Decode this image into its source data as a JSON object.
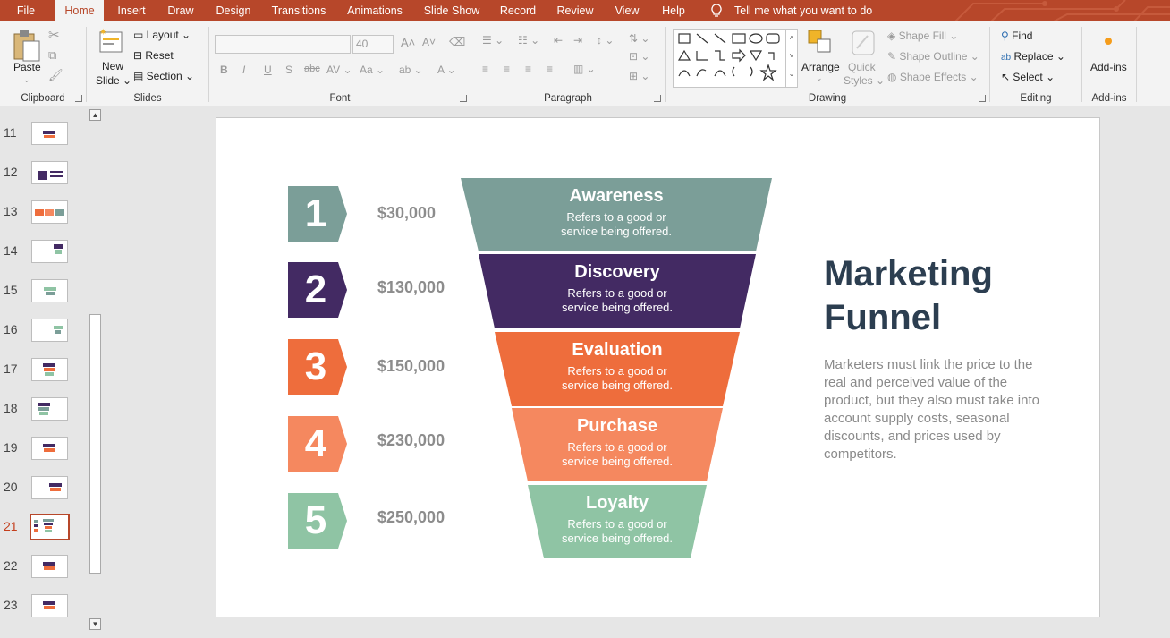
{
  "tabs": [
    "File",
    "Home",
    "Insert",
    "Draw",
    "Design",
    "Transitions",
    "Animations",
    "Slide Show",
    "Record",
    "Review",
    "View",
    "Help"
  ],
  "active_tab": "Home",
  "tell_me": "Tell me what you want to do",
  "ribbon": {
    "clipboard": {
      "label": "Clipboard",
      "paste": "Paste"
    },
    "slides": {
      "label": "Slides",
      "new_slide_1": "New",
      "new_slide_2": "Slide",
      "layout": "Layout",
      "reset": "Reset",
      "section": "Section"
    },
    "font": {
      "label": "Font",
      "size": "40"
    },
    "paragraph": {
      "label": "Paragraph"
    },
    "drawing": {
      "label": "Drawing",
      "arrange": "Arrange",
      "quick_1": "Quick",
      "quick_2": "Styles",
      "shape_fill": "Shape Fill",
      "shape_outline": "Shape Outline",
      "shape_effects": "Shape Effects"
    },
    "editing": {
      "label": "Editing",
      "find": "Find",
      "replace": "Replace",
      "select": "Select"
    },
    "addins": {
      "label": "Add-ins",
      "button": "Add-ins"
    }
  },
  "thumbnails": {
    "numbers": [
      "11",
      "12",
      "13",
      "14",
      "15",
      "16",
      "17",
      "18",
      "19",
      "20",
      "21",
      "22",
      "23"
    ],
    "current": "21"
  },
  "slide": {
    "title": "Marketing Funnel",
    "title_line1": "Marketing",
    "title_line2": "Funnel",
    "description": "Marketers must link the price to the real and perceived value of the product, but they also must take into account supply costs, seasonal discounts, and prices used by competitors.",
    "steps": [
      {
        "number": "1",
        "price": "$30,000",
        "stage": "Awareness",
        "desc_1": "Refers to a good or",
        "desc_2": "service being offered.",
        "color": "#7b9e98"
      },
      {
        "number": "2",
        "price": "$130,000",
        "stage": "Discovery",
        "desc_1": "Refers to a good or",
        "desc_2": "service being offered.",
        "color": "#432a63"
      },
      {
        "number": "3",
        "price": "$150,000",
        "stage": "Evaluation",
        "desc_1": "Refers to a good or",
        "desc_2": "service being offered.",
        "color": "#ee6d3c"
      },
      {
        "number": "4",
        "price": "$230,000",
        "stage": "Purchase",
        "desc_1": "Refers to a good or",
        "desc_2": "service being offered.",
        "color": "#f5885f"
      },
      {
        "number": "5",
        "price": "$250,000",
        "stage": "Loyalty",
        "desc_1": "Refers to a good or",
        "desc_2": "service being offered.",
        "color": "#8fc4a4"
      }
    ]
  },
  "colors": {
    "accent": "#b7472a",
    "title": "#2c3e50"
  }
}
